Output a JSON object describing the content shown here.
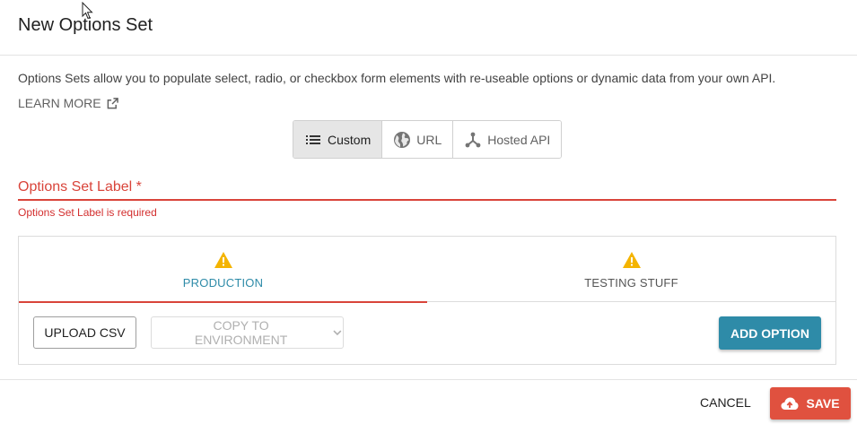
{
  "dialog": {
    "title": "New Options Set",
    "description": "Options Sets allow you to populate select, radio, or checkbox form elements with re-useable options or dynamic data from your own API.",
    "learn_more": "LEARN MORE"
  },
  "source_types": [
    {
      "label": "Custom",
      "icon": "list-icon",
      "active": true
    },
    {
      "label": "URL",
      "icon": "globe-icon",
      "active": false
    },
    {
      "label": "Hosted API",
      "icon": "api-icon",
      "active": false
    }
  ],
  "label_field": {
    "label": "Options Set Label *",
    "error": "Options Set Label is required"
  },
  "environments": {
    "tabs": [
      {
        "label": "PRODUCTION",
        "icon": "warning-icon",
        "active": true
      },
      {
        "label": "TESTING STUFF",
        "icon": "warning-icon",
        "active": false
      }
    ],
    "upload_csv": "UPLOAD CSV",
    "copy_to_env": "COPY TO ENVIRONMENT",
    "add_option": "ADD OPTION"
  },
  "footer": {
    "cancel": "CANCEL",
    "save": "SAVE"
  },
  "colors": {
    "accent": "#2e8ba8",
    "error": "#d9443a",
    "warning": "#f4b400",
    "save": "#e0513f"
  }
}
